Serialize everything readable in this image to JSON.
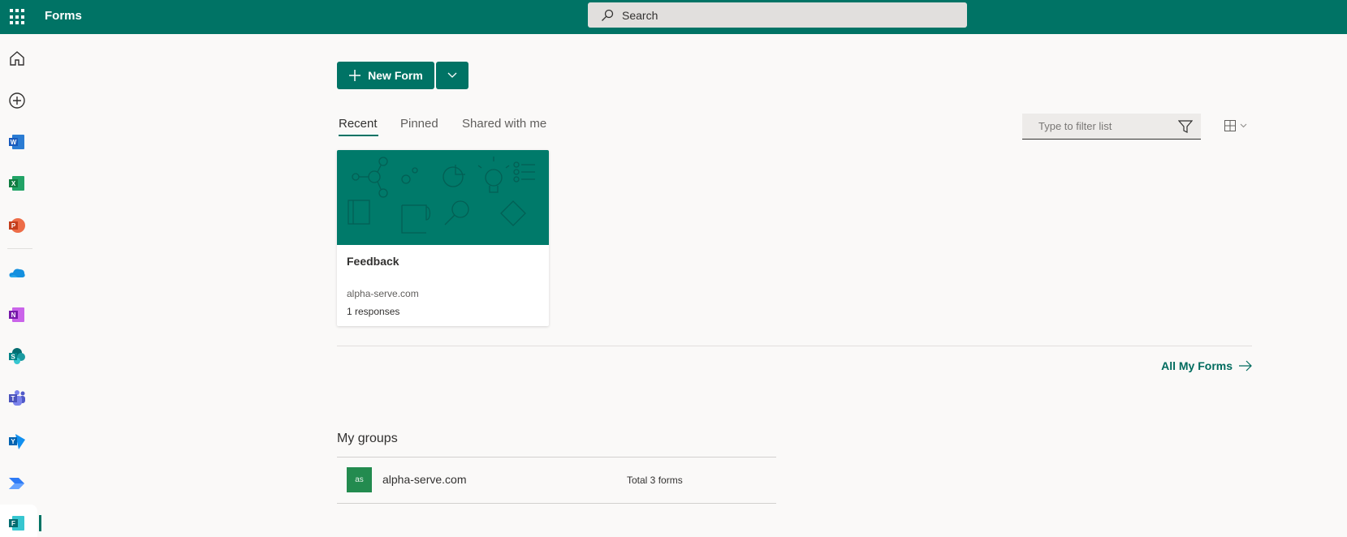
{
  "header": {
    "app_title": "Forms",
    "search_placeholder": "Search"
  },
  "sidebar": {
    "items": [
      "home",
      "create",
      "word",
      "excel",
      "powerpoint",
      "onedrive",
      "onenote",
      "sharepoint",
      "teams",
      "yammer",
      "power-automate",
      "forms"
    ]
  },
  "toolbar": {
    "new_form_label": "New Form"
  },
  "tabs": [
    {
      "label": "Recent",
      "active": true
    },
    {
      "label": "Pinned"
    },
    {
      "label": "Shared with me"
    }
  ],
  "filter": {
    "placeholder": "Type to filter list"
  },
  "forms": [
    {
      "title": "Feedback",
      "owner": "alpha-serve.com",
      "responses": "1 responses"
    }
  ],
  "all_forms_link": "All My Forms",
  "groups": {
    "title": "My groups",
    "items": [
      {
        "initials": "as",
        "name": "alpha-serve.com",
        "count": "Total 3 forms",
        "color": "#238b4f"
      }
    ]
  },
  "colors": {
    "brand": "#007365"
  }
}
